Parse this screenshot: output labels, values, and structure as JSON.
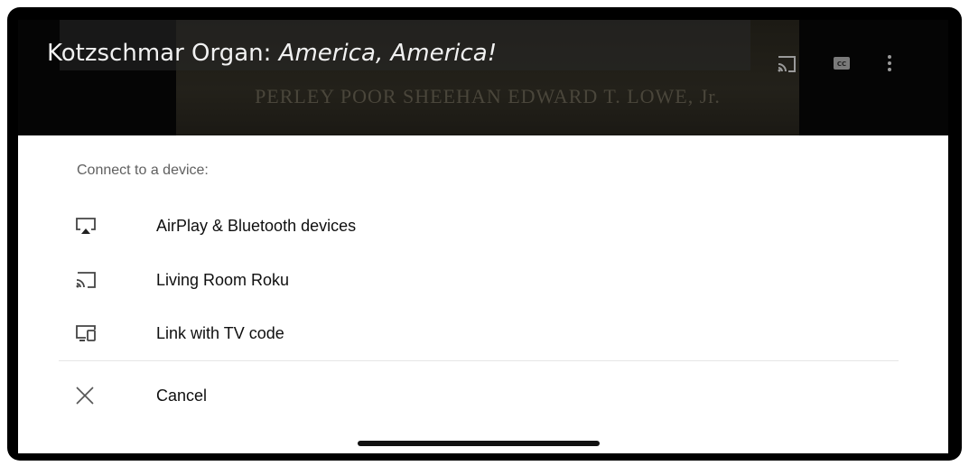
{
  "video": {
    "title_plain": "Kotzschmar Organ: ",
    "title_italic": "America, America!",
    "poster_text": "PERLEY POOR SHEEHAN   EDWARD T. LOWE, Jr."
  },
  "sheet": {
    "header": "Connect to a device:",
    "items": [
      {
        "label": "AirPlay & Bluetooth devices",
        "icon": "airplay-icon"
      },
      {
        "label": "Living Room Roku",
        "icon": "cast-icon"
      },
      {
        "label": "Link with TV code",
        "icon": "tv-code-icon"
      }
    ],
    "cancel": {
      "label": "Cancel",
      "icon": "close-icon"
    }
  }
}
